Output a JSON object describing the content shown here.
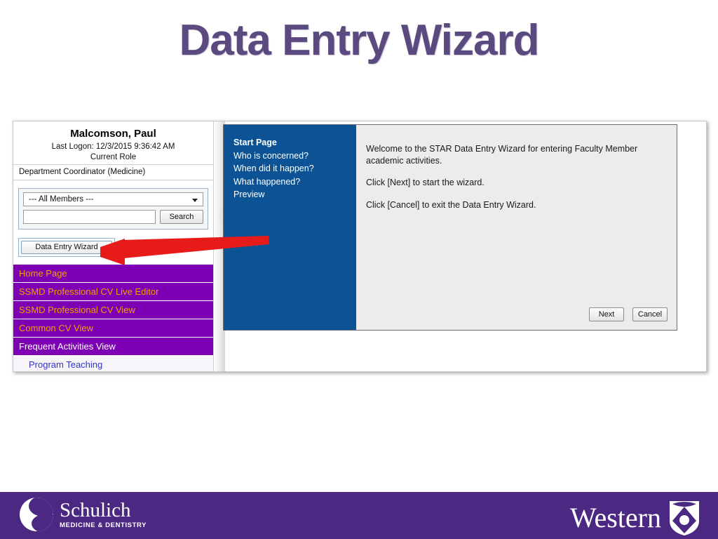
{
  "slide": {
    "title": "Data Entry Wizard"
  },
  "app": {
    "user": {
      "name": "Malcomson, Paul",
      "last_logon": "Last Logon: 12/3/2015 9:36:42 AM",
      "current_role_label": "Current Role",
      "current_role_value": "Department Coordinator (Medicine)"
    },
    "search": {
      "member_filter_selected": "--- All Members ---",
      "search_value": "",
      "search_placeholder": "",
      "search_button": "Search"
    },
    "wizard_launch_button": "Data Entry Wizard",
    "nav": [
      {
        "label": "Home Page",
        "style": "gold"
      },
      {
        "label": "SSMD Professional CV Live Editor",
        "style": "gold"
      },
      {
        "label": "SSMD Professional CV View",
        "style": "gold"
      },
      {
        "label": "Common CV View",
        "style": "gold"
      },
      {
        "label": "Frequent Activities View",
        "style": "white"
      }
    ],
    "nav_sub": [
      {
        "label": "Program Teaching"
      }
    ],
    "splitter_grip": "::::::"
  },
  "wizard": {
    "steps": [
      {
        "label": "Start Page",
        "active": true
      },
      {
        "label": "Who is concerned?",
        "active": false
      },
      {
        "label": "When did it happen?",
        "active": false
      },
      {
        "label": "What happened?",
        "active": false
      },
      {
        "label": "Preview",
        "active": false
      }
    ],
    "paragraphs": [
      "Welcome to the STAR Data Entry Wizard for entering Faculty Member academic activities.",
      "Click [Next] to start the wizard.",
      "Click [Cancel] to exit the Data Entry Wizard."
    ],
    "next_button": "Next",
    "cancel_button": "Cancel"
  },
  "footer": {
    "schulich_name": "Schulich",
    "schulich_sub": "MEDICINE & DENTISTRY",
    "western_name": "Western"
  },
  "colors": {
    "title_purple": "#5B4A80",
    "nav_purple": "#7D00B5",
    "nav_gold": "#F0A000",
    "wizard_blue": "#0B5394",
    "brand_purple": "#4B2882",
    "arrow_red": "#E81B1B"
  }
}
